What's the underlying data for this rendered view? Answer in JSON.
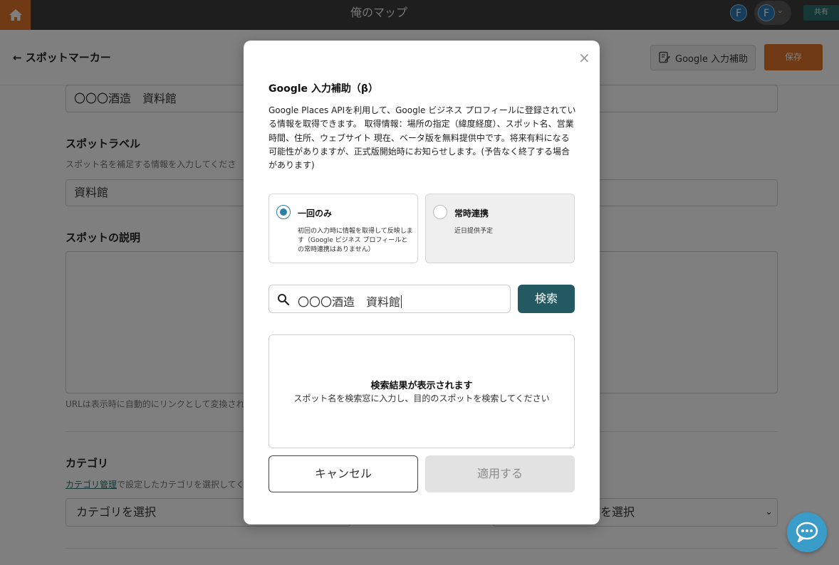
{
  "topbar": {
    "title": "俺のマップ",
    "avatar_initial": "F",
    "account_avatar_initial": "F",
    "share_label": "共有"
  },
  "header": {
    "back_label": "← スポットマーカー",
    "assist_label": "Google 入力補助",
    "save_label": "保存"
  },
  "form": {
    "spot_name_value": "〇〇〇酒造　資料館",
    "spot_label_title": "スポットラベル",
    "spot_label_help": "スポット名を補足する情報を入力してくださ",
    "spot_label_value": "資料館",
    "description_title": "スポットの説明",
    "description_help": "URLは表示時に自動的にリンクとして変換され",
    "category_title": "カテゴリ",
    "category_link": "カテゴリ管理",
    "category_help": "で設定したカテゴリを選択してく",
    "category_select": "カテゴリを選択",
    "select2_value": "を選択"
  },
  "modal": {
    "title": "Google 入力補助（β）",
    "description": "Google Places APIを利用して、Google ビジネス プロフィールに登録されている情報を取得できます。 取得情報：場所の指定（緯度経度）、スポット名、営業時間、住所、ウェブサイト 現在、ベータ版を無料提供中です。将来有料になる可能性がありますが、正式版開始時にお知らせします。(予告なく終了する場合があります)",
    "options": [
      {
        "title": "一回のみ",
        "desc": "初回の入力時に情報を取得して反映します（Google ビジネス プロフィールとの常時連携はありません）",
        "selected": true,
        "disabled": false
      },
      {
        "title": "常時連携",
        "desc": "近日提供予定",
        "selected": false,
        "disabled": true
      }
    ],
    "search_value": "〇〇〇酒造　資料館",
    "search_button": "検索",
    "results_title": "検索結果が表示されます",
    "results_sub": "スポット名を検索窓に入力し、目的のスポットを検索してください",
    "cancel_label": "キャンセル",
    "apply_label": "適用する"
  },
  "icons": {
    "home": "home-icon",
    "close": "close-icon",
    "search": "search-icon",
    "assist": "edit-document-icon",
    "chat": "chat-icon",
    "chevron": "chevron-down-icon"
  },
  "colors": {
    "accent": "#e0742a",
    "teal": "#235a61",
    "radio": "#2a7fa3",
    "chat": "#3a9cc8"
  }
}
